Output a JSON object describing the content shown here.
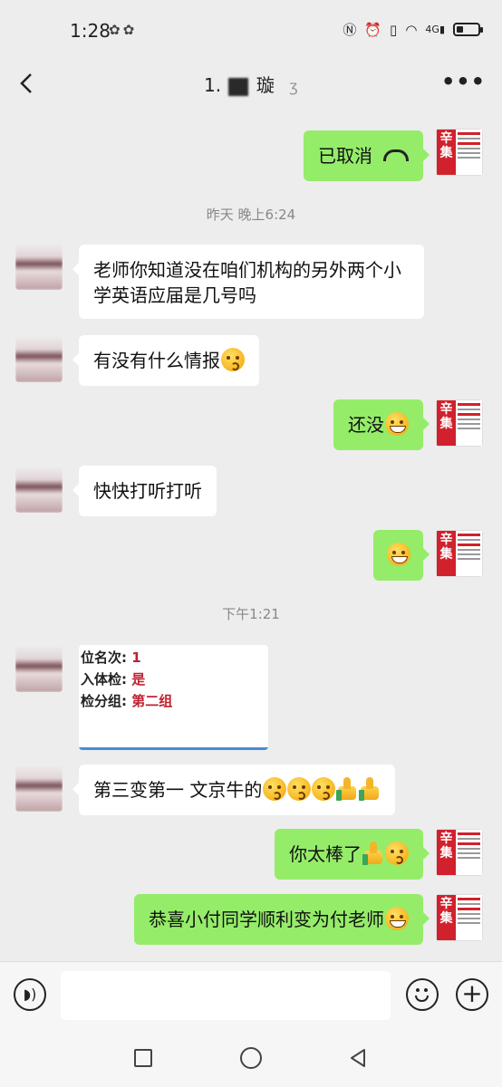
{
  "status_bar": {
    "time": "1:28",
    "left_icons": [
      "wechat-icon",
      "wechat-icon"
    ],
    "right_icons": [
      "nfc-icon",
      "alarm-icon",
      "vibrate-icon",
      "wifi-icon",
      "signal-4g-icon",
      "battery-icon"
    ],
    "network": "4G",
    "battery_level": 0.3
  },
  "header": {
    "title_prefix": "1.",
    "title_suffix": "璇",
    "back_icon": "chevron-left-icon",
    "ear_icon": "ear-icon",
    "more_label": "•••"
  },
  "messages": [
    {
      "side": "right",
      "text": "已取消",
      "icon": "phone-hangup-icon"
    },
    {
      "type": "time",
      "text": "昨天 晚上6:24"
    },
    {
      "side": "left",
      "text": "老师你知道没在咱们机构的另外两个小学英语应届是几号吗"
    },
    {
      "side": "left",
      "text": "有没有什么情报",
      "emoji": "kiss-face-emoji"
    },
    {
      "side": "right",
      "text": "还没",
      "emoji": "laugh-cry-emoji"
    },
    {
      "side": "left",
      "text": "快快打听打听"
    },
    {
      "side": "right",
      "text": "",
      "emoji": "grin-emoji"
    },
    {
      "type": "time",
      "text": "下午1:21"
    },
    {
      "side": "left",
      "type": "card",
      "lines": [
        {
          "label": "位名次:",
          "value": "1"
        },
        {
          "label": "入体检:",
          "value": "是"
        },
        {
          "label": "检分组:",
          "value": "第二组"
        }
      ]
    },
    {
      "side": "left",
      "text": "第三变第一 文京牛的",
      "emoji": "kiss-face-emoji x3, thumbs-up-emoji x2"
    },
    {
      "side": "right",
      "text": "你太棒了",
      "emoji": "thumbs-up-emoji, kiss-face-emoji"
    },
    {
      "side": "right",
      "text": "恭喜小付同学顺利变为付老师",
      "emoji": "grin-emoji"
    }
  ],
  "book_avatar": {
    "char1": "辛",
    "char2": "集"
  },
  "input_bar": {
    "voice_icon": "voice-icon",
    "placeholder": "",
    "emoji_icon": "emoji-icon",
    "plus_icon": "plus-icon"
  },
  "system_nav": {
    "icons": [
      "recent-apps-icon",
      "home-icon",
      "back-icon"
    ]
  }
}
